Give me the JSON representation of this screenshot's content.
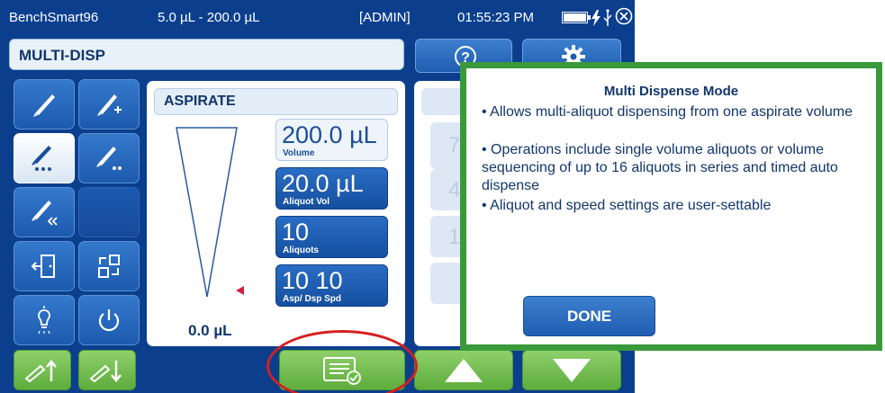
{
  "status": {
    "device_name": "BenchSmart96",
    "volume_range": "5.0 µL - 200.0 µL",
    "user": "[ADMIN]",
    "time": "01:55:23 PM"
  },
  "mode": {
    "title": "MULTI-DISP"
  },
  "top_buttons": {
    "help_icon": "help-icon",
    "settings_icon": "gear-icon"
  },
  "sidebar": [
    {
      "icon": "pipette-aspirate-icon",
      "selected": false
    },
    {
      "icon": "pipette-add-icon",
      "selected": false
    },
    {
      "icon": "pipette-multi-dispense-icon",
      "selected": true
    },
    {
      "icon": "pipette-dilute-icon",
      "selected": false
    },
    {
      "icon": "pipette-reverse-icon",
      "selected": false
    },
    {
      "icon": "exit-door-icon",
      "selected": false
    },
    {
      "icon": "program-transfer-icon",
      "selected": false
    },
    {
      "icon": "light-bulb-icon",
      "selected": false
    },
    {
      "icon": "power-icon",
      "selected": false
    }
  ],
  "aspirate_panel": {
    "title": "ASPIRATE",
    "current_volume": "0.0 µL",
    "level_fraction": 0.0,
    "volume": {
      "value": "200.0 µL",
      "label": "Volume"
    },
    "aliquot_vol": {
      "value": "20.0 µL",
      "label": "Aliquot Vol"
    },
    "aliquots": {
      "value": "10",
      "label": "Aliquots"
    },
    "speeds": {
      "value": "10  10",
      "label": "Asp/ Dsp Spd"
    }
  },
  "keypad_partial": [
    "7",
    "4",
    "1"
  ],
  "bottom_bar": {
    "tip_eject_up_icon": "tip-up-icon",
    "tip_eject_down_icon": "tip-down-icon",
    "info_icon": "list-check-icon",
    "up_icon": "arrow-up-icon",
    "down_icon": "arrow-down-icon"
  },
  "dialog": {
    "title": "Multi Dispense Mode",
    "bullets": [
      "• Allows multi-aliquot dispensing from one aspirate volume",
      "• Operations include single volume aliquots or volume sequencing of up to 16 aliquots in series and timed auto dispense",
      "• Aliquot and speed settings are user-settable"
    ],
    "done_label": "DONE"
  },
  "colors": {
    "screen_bg": "#0b3f8e",
    "button_blue": "#1f5eb0",
    "button_green": "#6bbd47",
    "dialog_border": "#3a9a3a",
    "highlight_circle": "#d42020"
  }
}
